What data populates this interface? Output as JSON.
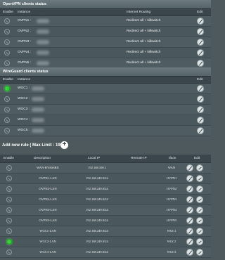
{
  "openvpn": {
    "title": "OpenVPN clients status",
    "headers": {
      "enable": "Enable",
      "instance": "Instance",
      "routing": "Internet Routing",
      "edit": "Edit"
    },
    "rows": [
      {
        "instance": "OVPN1 : ",
        "routing": "Redirect all + killswitch",
        "enabled": false
      },
      {
        "instance": "OVPN2 : ",
        "routing": "Redirect all + killswitch",
        "enabled": false
      },
      {
        "instance": "OVPN3 : ",
        "routing": "Redirect all + killswitch",
        "enabled": false
      },
      {
        "instance": "OVPN4 : ",
        "routing": "Redirect all + killswitch",
        "enabled": false
      },
      {
        "instance": "OVPN5 : ",
        "routing": "Redirect all + killswitch",
        "enabled": false
      }
    ]
  },
  "wireguard": {
    "title": "WireGuard clients status",
    "headers": {
      "enable": "Enable",
      "instance": "Instance",
      "edit": "Edit"
    },
    "rows": [
      {
        "instance": "WGC1 : ",
        "enabled": true
      },
      {
        "instance": "WGC2 : ",
        "enabled": false
      },
      {
        "instance": "WGC3 : ",
        "enabled": false
      },
      {
        "instance": "WGC4 : ",
        "enabled": false
      },
      {
        "instance": "WGC5 : ",
        "enabled": false
      }
    ]
  },
  "rules": {
    "add_label": "Add new rule ( Max Limit : 199 )",
    "headers": {
      "enable": "Enable",
      "description": "Description",
      "local_ip": "Local IP",
      "remote_ip": "Remote IP",
      "iface": "Iface",
      "edit": "Edit"
    },
    "rows": [
      {
        "description": "WAN-BYASSRU",
        "local_ip": "192.168.100.1",
        "remote_ip": "",
        "iface": "WAN",
        "enabled": false
      },
      {
        "description": "OVPN1-LAN",
        "local_ip": "192.168.249.0/24",
        "remote_ip": "",
        "iface": "OVPN1",
        "enabled": false
      },
      {
        "description": "OVPN2-LAN",
        "local_ip": "192.168.249.0/24",
        "remote_ip": "",
        "iface": "OVPN2",
        "enabled": false
      },
      {
        "description": "OVPN3-LAN",
        "local_ip": "192.168.249.0/24",
        "remote_ip": "",
        "iface": "OVPN3",
        "enabled": false
      },
      {
        "description": "OVPN4-LAN",
        "local_ip": "192.168.249.0/24",
        "remote_ip": "",
        "iface": "OVPN4",
        "enabled": false
      },
      {
        "description": "OVPN5-LAN",
        "local_ip": "192.168.249.0/24",
        "remote_ip": "",
        "iface": "OVPN5",
        "enabled": false
      },
      {
        "description": "WGC1-LAN",
        "local_ip": "192.168.249.0/24",
        "remote_ip": "",
        "iface": "WGC1",
        "enabled": false
      },
      {
        "description": "WGC2-LAN",
        "local_ip": "192.168.249.0/24",
        "remote_ip": "",
        "iface": "WGC2",
        "enabled": true
      },
      {
        "description": "WGC3-LAN",
        "local_ip": "192.168.249.0/24",
        "remote_ip": "",
        "iface": "WGC3",
        "enabled": false
      }
    ]
  },
  "colors": {
    "bg": "#4d595d",
    "toggle_on": "#36d13a",
    "toggle_off": "#8b989c"
  }
}
